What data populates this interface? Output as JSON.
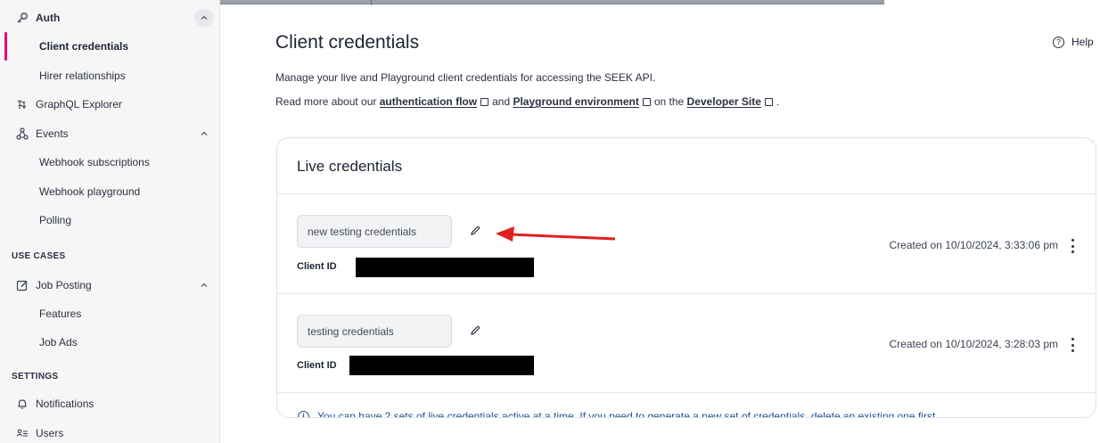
{
  "sidebar": {
    "items": [
      {
        "label": "Auth",
        "icon": "key-icon",
        "type": "section"
      },
      {
        "label": "Client credentials",
        "type": "sub",
        "active": true
      },
      {
        "label": "Hirer relationships",
        "type": "sub"
      },
      {
        "label": "GraphQL Explorer",
        "icon": "graphql-icon",
        "type": "item"
      },
      {
        "label": "Events",
        "icon": "events-icon",
        "type": "section"
      },
      {
        "label": "Webhook subscriptions",
        "type": "sub"
      },
      {
        "label": "Webhook playground",
        "type": "sub"
      },
      {
        "label": "Polling",
        "type": "sub"
      },
      {
        "label": "Job Posting",
        "icon": "edit-icon",
        "type": "section"
      },
      {
        "label": "Features",
        "type": "sub"
      },
      {
        "label": "Job Ads",
        "type": "sub"
      },
      {
        "label": "Notifications",
        "icon": "bell-icon",
        "type": "item"
      },
      {
        "label": "Users",
        "icon": "users-icon",
        "type": "item"
      }
    ],
    "headings": {
      "use_cases": "USE CASES",
      "settings": "SETTINGS"
    }
  },
  "main": {
    "title": "Client credentials",
    "help": "Help",
    "intro": "Manage your live and Playground client credentials for accessing the SEEK API.",
    "intro2": {
      "prefix": "Read more about our",
      "link1": "authentication flow",
      "mid": "and",
      "link2": "Playground environment",
      "mid2": "on the",
      "link3": "Developer Site",
      "suffix": "."
    }
  },
  "card": {
    "title": "Live credentials",
    "credentials": [
      {
        "name": "new testing credentials",
        "client_id_label": "Client ID",
        "created": "Created on 10/10/2024, 3:33:06 pm"
      },
      {
        "name": "testing credentials",
        "client_id_label": "Client ID",
        "created": "Created on 10/10/2024, 3:28:03 pm"
      }
    ],
    "info": "You can have 2 sets of live credentials active at a time. If you need to generate a new set of credentials, delete an existing one first."
  },
  "colors": {
    "accent_pink": "#e60278",
    "info_blue": "#1f4f8f",
    "arrow_red": "#e02020"
  }
}
